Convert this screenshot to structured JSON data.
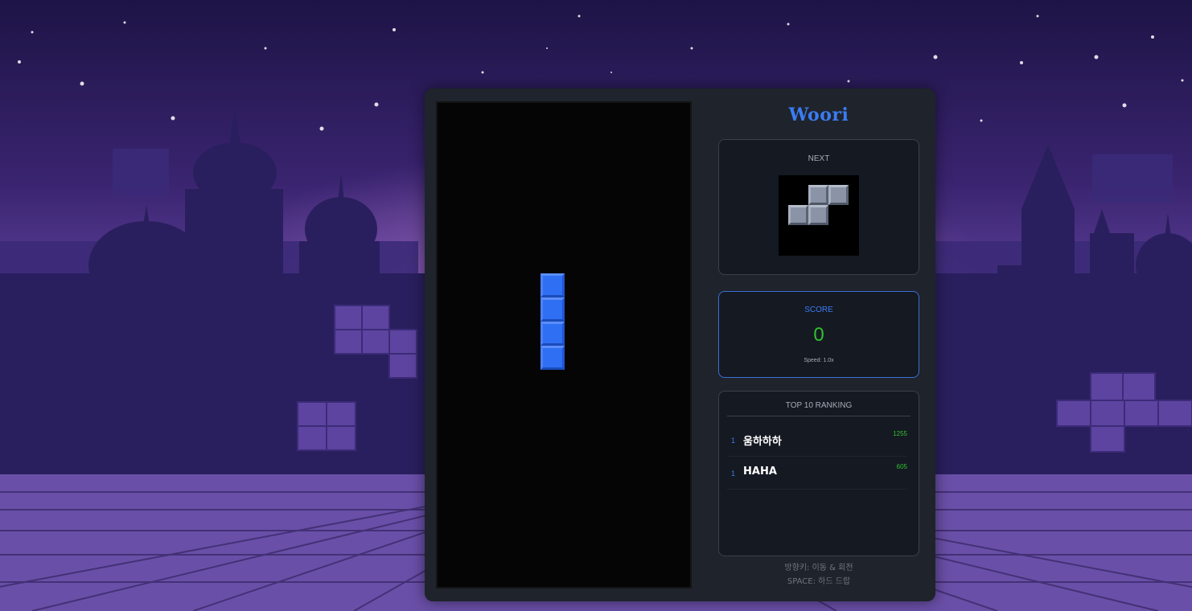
{
  "game": {
    "title": "Woori",
    "next_label": "NEXT",
    "next_piece": "S",
    "current_piece": "I",
    "score_label": "SCORE",
    "score": "0",
    "speed": "Speed: 1.0x"
  },
  "ranking": {
    "title": "TOP 10 RANKING",
    "entries": [
      {
        "rank": "1",
        "name": "움하하하",
        "score": "1255"
      },
      {
        "rank": "1",
        "name": "HAHA",
        "score": "605"
      }
    ]
  },
  "help": {
    "line1": "방향키: 이동 & 회전",
    "line2": "SPACE: 하드 드랍"
  },
  "colors": {
    "accent": "#3a7cf2",
    "score": "#2fc22f",
    "piece_i": "#2f6ff4",
    "piece_next": "#8a94a6"
  }
}
